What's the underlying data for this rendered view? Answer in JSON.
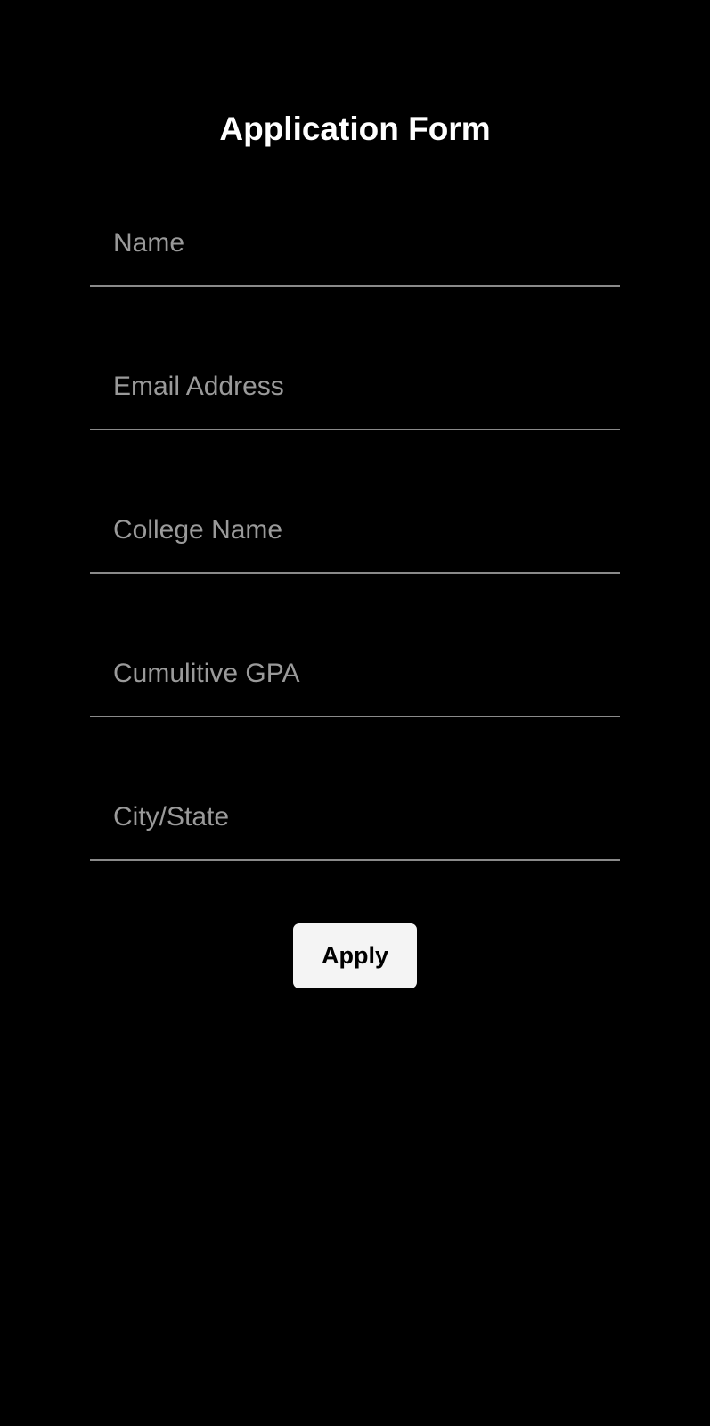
{
  "form": {
    "title": "Application Form",
    "fields": [
      {
        "placeholder": "Name",
        "value": ""
      },
      {
        "placeholder": "Email Address",
        "value": ""
      },
      {
        "placeholder": "College Name",
        "value": ""
      },
      {
        "placeholder": "Cumulitive GPA",
        "value": ""
      },
      {
        "placeholder": "City/State",
        "value": ""
      }
    ],
    "submit_label": "Apply"
  },
  "colors": {
    "background": "#000000",
    "title_text": "#ffffff",
    "placeholder_text": "#9a9a9a",
    "field_underline": "#8a8a8a",
    "button_background": "#f4f4f4",
    "button_text": "#000000"
  }
}
